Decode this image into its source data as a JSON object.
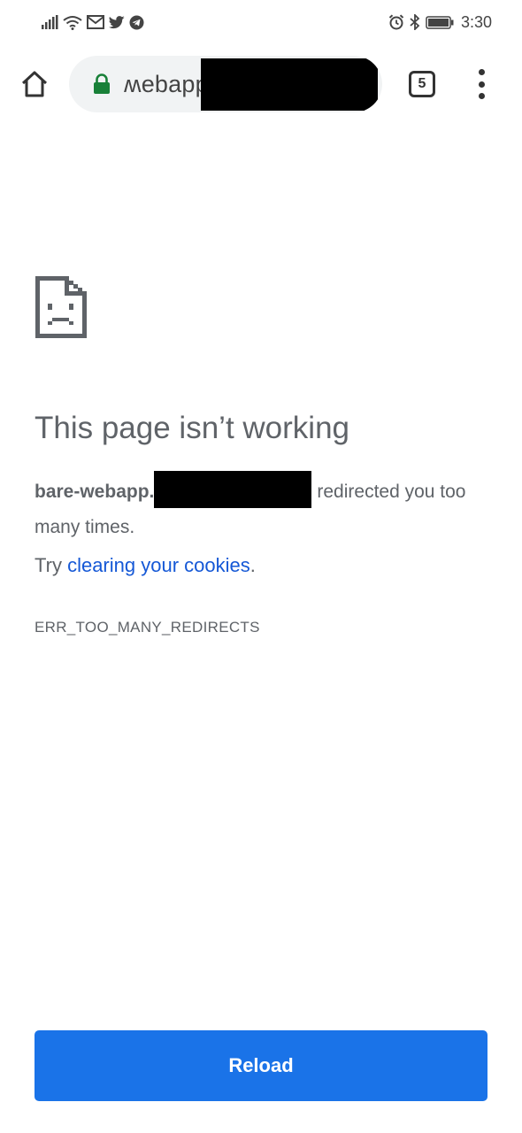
{
  "status_bar": {
    "time": "3:30",
    "left_icons": [
      "signal-icon",
      "wifi-icon",
      "gmail-icon",
      "twitter-icon",
      "telegram-icon"
    ],
    "right_icons": [
      "alarm-icon",
      "bluetooth-icon",
      "battery-icon"
    ]
  },
  "toolbar": {
    "url_text": "ʍebapp.",
    "tab_count": "5"
  },
  "error": {
    "title": "This page isn’t working",
    "host": "bare-webapp.",
    "message": "redirected you too many times.",
    "suggestion_prefix": "Try",
    "suggestion_link": "clearing your cookies",
    "suggestion_suffix": ".",
    "code": "ERR_TOO_MANY_REDIRECTS"
  },
  "reload_label": "Reload",
  "colors": {
    "accent": "#1a73e8",
    "lock": "#188038",
    "text": "#5f6368",
    "link": "#1558d6"
  }
}
